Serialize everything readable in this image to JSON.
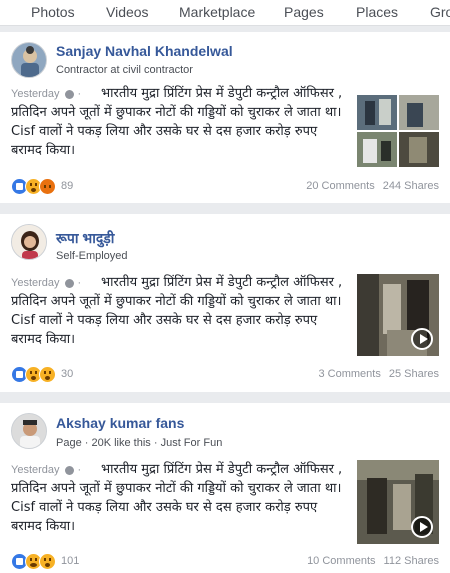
{
  "tabs": [
    "Photos",
    "Videos",
    "Marketplace",
    "Pages",
    "Places",
    "Gro"
  ],
  "posts": [
    {
      "author": "Sanjay Navhal Khandelwal",
      "subtitle": "Contractor at civil contractor",
      "time": "Yesterday",
      "dot": "·",
      "text": "भारतीय मुद्रा प्रिंटिंग प्रेस में डेपुटी कन्ट्रौल ऑफिसर , प्रतिदिन अपने जूतों में छुपाकर नोटों की गड्डियों को चुराकर ले जाता था। Cisf वालों ने पकड़ लिया और उसके घर से दस हजार करोड़ रुपए बरामद किया।",
      "reaction_count": "89",
      "comments": "20 Comments",
      "shares": "244 Shares",
      "reactions": [
        "like",
        "wow",
        "angry"
      ]
    },
    {
      "author": "रूपा भादुड़ी",
      "subtitle": "Self-Employed",
      "time": "Yesterday",
      "dot": "·",
      "text": "भारतीय मुद्रा प्रिंटिंग प्रेस में डेपुटी कन्ट्रौल ऑफिसर , प्रतिदिन अपने जूतों में छुपाकर नोटों की गड्डियों को चुराकर ले जाता था। Cisf वालों ने पकड़ लिया और उसके घर से दस हजार करोड़ रुपए बरामद किया।",
      "reaction_count": "30",
      "comments": "3 Comments",
      "shares": "25 Shares",
      "reactions": [
        "like",
        "wow",
        "wow"
      ]
    },
    {
      "author": "Akshay kumar fans",
      "subtitle_parts": [
        "Page",
        "20K like this",
        "Just For Fun"
      ],
      "time": "Yesterday",
      "dot": "·",
      "text": "भारतीय मुद्रा प्रिंटिंग प्रेस में डेपुटी कन्ट्रौल ऑफिसर , प्रतिदिन अपने जूतों में छुपाकर नोटों की गड्डियों को चुराकर ले जाता था। Cisf वालों ने पकड़ लिया और उसके घर से दस हजार करोड़ रुपए बरामद किया।",
      "reaction_count": "101",
      "comments": "10 Comments",
      "shares": "112 Shares",
      "reactions": [
        "like",
        "haha",
        "wow"
      ]
    }
  ],
  "colors": {
    "link": "#365899",
    "like": "#3578e5",
    "wow": "#f7b125",
    "angry": "#e9710f",
    "muted": "#90949c"
  },
  "icons": [
    "globe-icon",
    "settings-icon",
    "play-icon",
    "like-reaction-icon",
    "wow-reaction-icon",
    "angry-reaction-icon",
    "haha-reaction-icon"
  ]
}
